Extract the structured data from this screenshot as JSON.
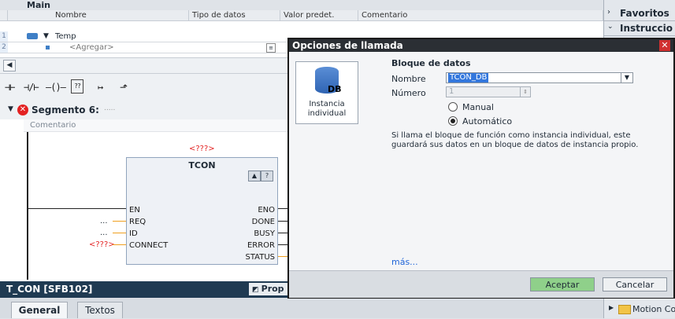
{
  "editor": {
    "title": "Main",
    "columns": [
      "Nombre",
      "Tipo de datos",
      "Valor predet.",
      "Comentario"
    ],
    "rows": [
      {
        "num": "1",
        "name": "Temp"
      },
      {
        "num": "2",
        "name": "<Agregar>"
      }
    ]
  },
  "segment": {
    "title": "Segmento 6:",
    "title_trail": ".....",
    "comment": "Comentario",
    "instance_label": "<???>",
    "block": {
      "name": "TCON",
      "inputs": [
        "EN",
        "REQ",
        "ID",
        "CONNECT"
      ],
      "outputs": [
        "ENO",
        "DONE",
        "BUSY",
        "ERROR",
        "STATUS"
      ],
      "input_values": [
        "",
        "...",
        "...",
        "<???>"
      ]
    }
  },
  "bottom": {
    "title": "T_CON [SFB102]",
    "tabs": [
      "General",
      "Textos"
    ],
    "properties_label": "Prop"
  },
  "right_panel": {
    "favoritos": "Favoritos",
    "instrucciones": "Instruccio",
    "motion": "Motion Co"
  },
  "dialog": {
    "title": "Opciones de llamada",
    "instance_type_line1": "Instancia",
    "instance_type_line2": "individual",
    "db_icon_label": "DB",
    "section_title": "Bloque de datos",
    "nombre_label": "Nombre",
    "nombre_value": "TCON_DB",
    "numero_label": "Número",
    "numero_value": "1",
    "radio_manual": "Manual",
    "radio_auto": "Automático",
    "description": "Si llama el bloque de función como instancia individual, este guardará sus datos en un bloque de datos de instancia propio.",
    "more": "más...",
    "accept": "Aceptar",
    "cancel": "Cancelar"
  },
  "colors": {
    "accent": "#2b2f34",
    "error": "#e32222",
    "accept_btn": "#8fd08a",
    "link": "#1f64d8"
  }
}
